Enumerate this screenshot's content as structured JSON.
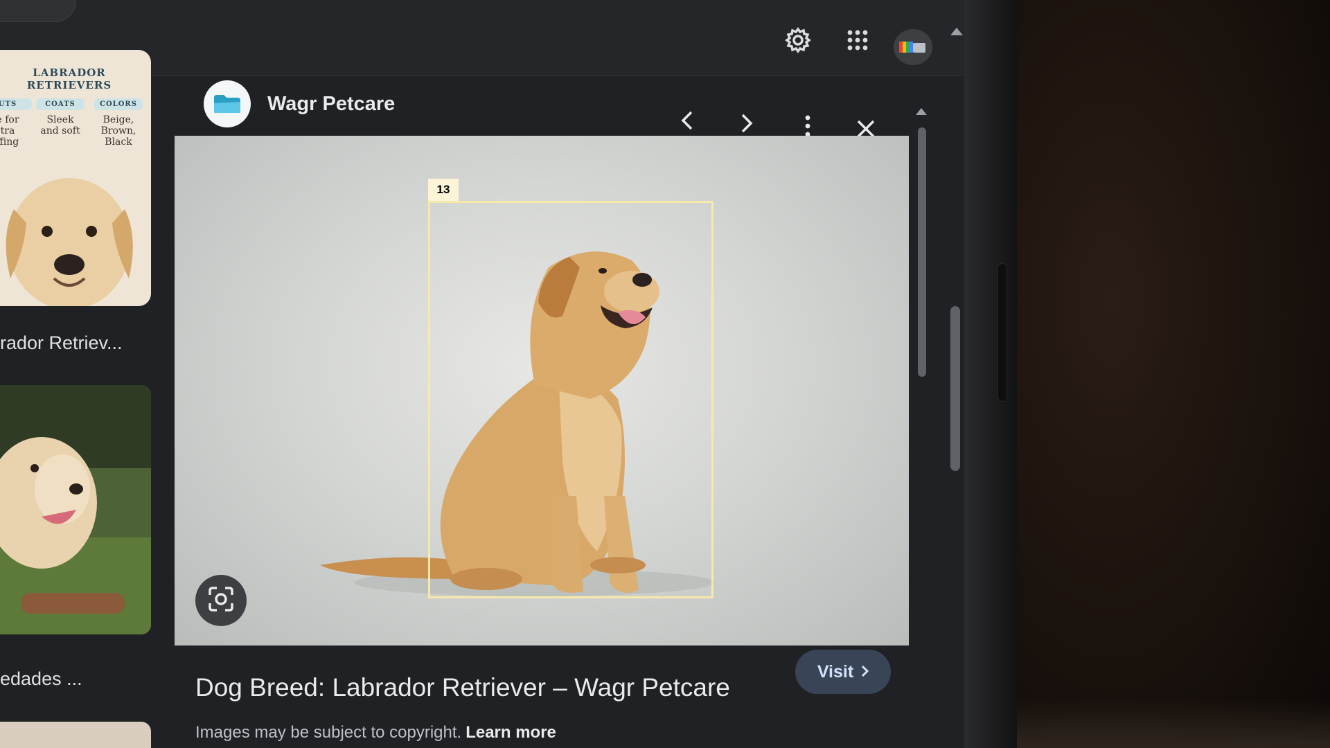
{
  "topbar": {
    "search_icon": "search-icon",
    "settings_icon": "gear-icon",
    "apps_icon": "apps-grid-icon",
    "avatar_icon": "account-avatar"
  },
  "results": [
    {
      "caption": "rador Retriev...",
      "infographic": {
        "title": "LABRADOR RETRIEVERS",
        "columns": [
          {
            "heading": "UTS",
            "body": "e for\ntra\nffing"
          },
          {
            "heading": "COATS",
            "body": "Sleek\nand soft"
          },
          {
            "heading": "COLORS",
            "body": "Beige,\nBrown,\nBlack"
          }
        ]
      }
    },
    {
      "caption": "edades ..."
    },
    {
      "caption": ""
    }
  ],
  "panel": {
    "site_name": "Wagr Petcare",
    "prev_icon": "chevron-left-icon",
    "next_icon": "chevron-right-icon",
    "more_icon": "more-vert-icon",
    "close_icon": "close-icon",
    "annotation_tag": "13",
    "lens_icon": "lens-icon",
    "title": "Dog Breed: Labrador Retriever – Wagr Petcare",
    "copyright_text": "Images may be subject to copyright.",
    "learn_more": "Learn more",
    "visit_label": "Visit"
  },
  "colors": {
    "background": "#202124",
    "accent_link": "#8ab4f8",
    "visit_button": "#394457",
    "annotation": "#f7e9a8"
  }
}
